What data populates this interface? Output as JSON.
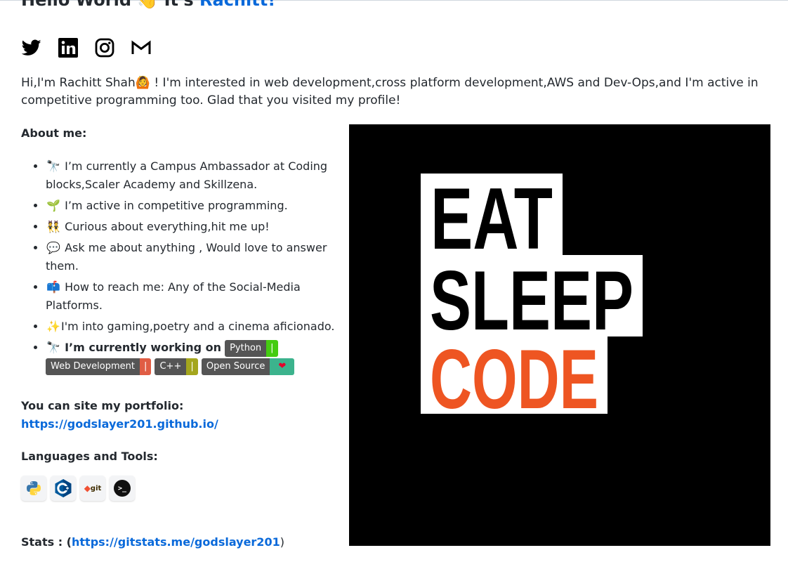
{
  "header": {
    "greeting": "Hello World",
    "wave_emoji": "👋",
    "its": "It's",
    "name": "Rachitt!"
  },
  "socials": [
    {
      "icon": "twitter-icon"
    },
    {
      "icon": "linkedin-icon"
    },
    {
      "icon": "instagram-icon"
    },
    {
      "icon": "gmail-icon"
    }
  ],
  "intro": {
    "text_before": "Hi,I'm Rachitt Shah",
    "emoji": "🙆",
    "text_after": " ! I'm interested in web development,cross platform development,AWS and Dev-Ops,and I'm active in competitive programming too. Glad that you visited my profile!"
  },
  "about": {
    "heading": "About me:",
    "items": [
      {
        "emoji": "🔭",
        "text": "I’m currently a Campus Ambassador at Coding blocks,Scaler Academy and Skillzena."
      },
      {
        "emoji": "🌱",
        "text": "I’m active in competitive programming."
      },
      {
        "emoji": "👯",
        "text": "Curious about everything,hit me up!"
      },
      {
        "emoji": "💬",
        "text": "Ask me about anything , Would love to answer them."
      },
      {
        "emoji": "📫",
        "text": "How to reach me: Any of the Social-Media Platforms."
      },
      {
        "emoji": "✨",
        "text": "I'm into gaming,poetry and a cinema aficionado."
      }
    ],
    "working_on": {
      "emoji": "🔭",
      "text": "I’m currently working on",
      "badges": [
        {
          "label": "Python",
          "value": "|",
          "color": "#4c1"
        },
        {
          "label": "Web Development",
          "value": "|",
          "color": "#e05d44"
        },
        {
          "label": "C++",
          "value": "|",
          "color": "#a4a61d"
        },
        {
          "label": "Open Source",
          "value": "❤",
          "color": "#3cb38d"
        }
      ]
    }
  },
  "portfolio": {
    "heading": "You can site my portfolio:",
    "url": "https://godslayer201.github.io/"
  },
  "languages": {
    "heading": "Languages and Tools:",
    "tools": [
      {
        "icon": "python-icon"
      },
      {
        "icon": "cplusplus-icon"
      },
      {
        "icon": "git-icon",
        "text": "git"
      },
      {
        "icon": "terminal-icon",
        "text": ">_"
      }
    ]
  },
  "stats": {
    "label": "Stats : (",
    "url": "https://gitstats.me/godslayer201",
    "close": ")"
  },
  "banner": {
    "line1": "EAT",
    "line2": "SLEEP",
    "line3": "CODE",
    "accent": "#ee5522"
  }
}
